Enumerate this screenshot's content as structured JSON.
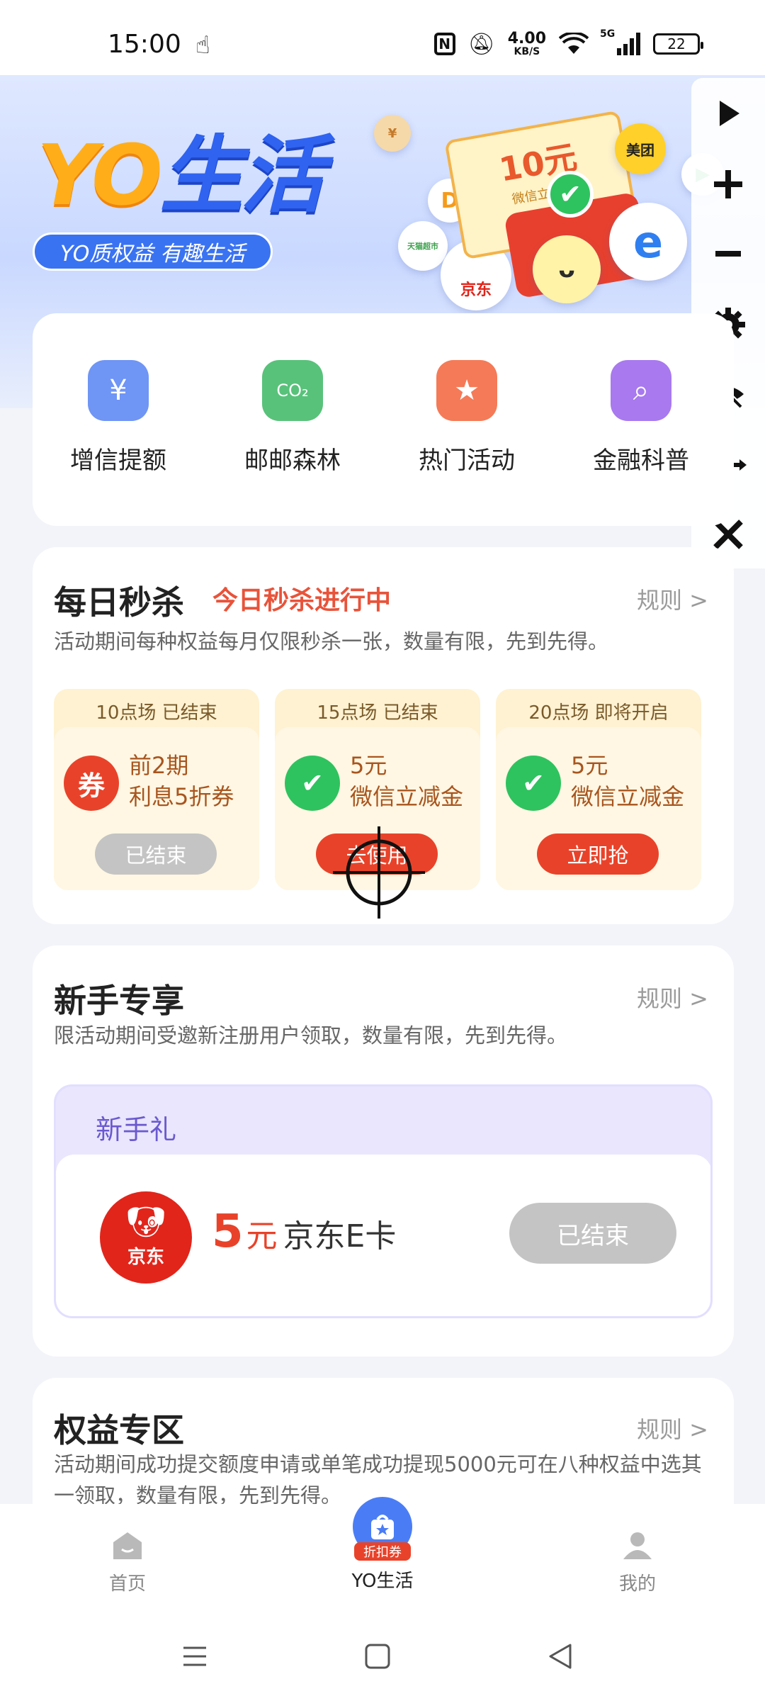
{
  "status_bar": {
    "time": "15:00",
    "net_speed_value": "4.00",
    "net_speed_unit": "KB/S",
    "signal_label": "5G",
    "battery": "22"
  },
  "banner": {
    "title_yo": "YO",
    "title_life": "生活",
    "slogan": "YO质权益 有趣生活",
    "coupon_amount": "10元",
    "coupon_sub": "微信立减金",
    "brand_meituan": "美团",
    "brand_jd": "京东",
    "brand_tmall": "天猫超市",
    "accent_blue": "#2f63f0",
    "accent_orange": "#ffae1a"
  },
  "float_panel": {
    "icons": [
      "play-icon",
      "plus-icon",
      "minus-icon",
      "settings-icon",
      "hide-eye-icon",
      "move-icon",
      "close-icon"
    ]
  },
  "quick_entries": [
    {
      "label": "增信提额",
      "icon": "wallet-icon",
      "color": "#6f95f5"
    },
    {
      "label": "邮邮森林",
      "icon": "co2-cloud-icon",
      "color": "#58c27a"
    },
    {
      "label": "热门活动",
      "icon": "star-bookmark-icon",
      "color": "#f57a57"
    },
    {
      "label": "金融科普",
      "icon": "search-document-icon",
      "color": "#a879ef"
    }
  ],
  "flash_sale": {
    "title": "每日秒杀",
    "live_status": "今日秒杀进行中",
    "rule": "规则 >",
    "desc": "活动期间每种权益每月仅限秒杀一张，数量有限，先到先得。",
    "slots": [
      {
        "session": "10点场 已结束",
        "line1": "前2期",
        "line2": "利息5折券",
        "icon": "券",
        "icon_color": "#e8432a",
        "button": "已结束",
        "button_state": "ended"
      },
      {
        "session": "15点场 已结束",
        "line1": "5元",
        "line2": "微信立减金",
        "icon": "✔",
        "icon_color": "#2ec35f",
        "button": "去使用",
        "button_state": "active"
      },
      {
        "session": "20点场 即将开启",
        "line1": "5元",
        "line2": "微信立减金",
        "icon": "✔",
        "icon_color": "#2ec35f",
        "button": "立即抢",
        "button_state": "active"
      }
    ]
  },
  "newbie": {
    "title": "新手专享",
    "rule": "规则 >",
    "desc": "限活动期间受邀新注册用户领取，数量有限，先到先得。",
    "gift_title": "新手礼",
    "jd_logo_text": "京东",
    "amount": "5",
    "unit": "元",
    "name": "京东E卡",
    "button": "已结束"
  },
  "rights": {
    "title": "权益专区",
    "rule": "规则 >",
    "desc": "活动期间成功提交额度申请或单笔成功提现5000元可在八种权益中选其一领取，数量有限，先到先得。"
  },
  "tabbar": {
    "tabs": [
      {
        "label": "首页"
      },
      {
        "label": "YO生活"
      },
      {
        "label": "我的"
      }
    ],
    "center_badge": "折扣券"
  }
}
